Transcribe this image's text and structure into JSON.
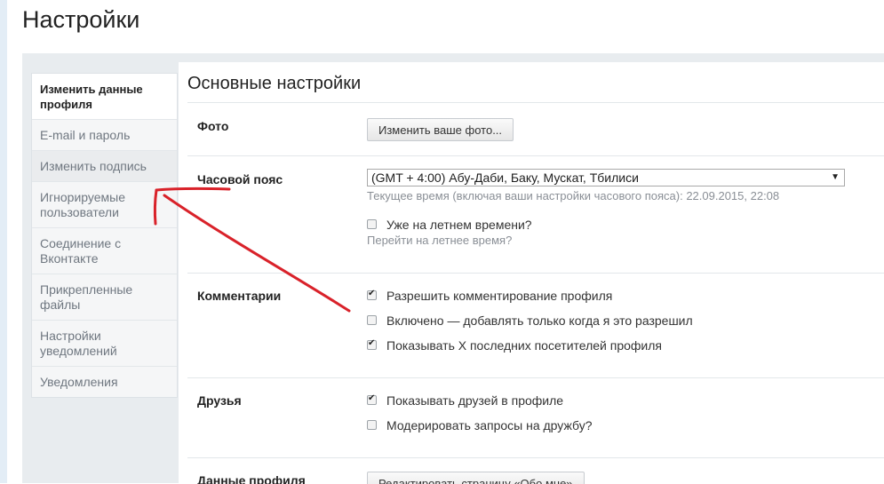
{
  "page_title": "Настройки",
  "sidebar": {
    "items": [
      {
        "label": "Изменить данные профиля"
      },
      {
        "label": "E-mail и пароль"
      },
      {
        "label": "Изменить подпись"
      },
      {
        "label": "Игнорируемые пользователи"
      },
      {
        "label": "Соединение с Вконтакте"
      },
      {
        "label": "Прикрепленные файлы"
      },
      {
        "label": "Настройки уведомлений"
      },
      {
        "label": "Уведомления"
      }
    ]
  },
  "main": {
    "title": "Основные настройки",
    "photo": {
      "label": "Фото",
      "button": "Изменить ваше фото..."
    },
    "timezone": {
      "label": "Часовой пояс",
      "selected": "(GMT + 4:00) Абу-Даби, Баку, Мускат, Тбилиси",
      "current_time": "Текущее время (включая ваши настройки часового пояса): 22.09.2015, 22:08",
      "dst_checkbox": "Уже на летнем времени?",
      "dst_hint": "Перейти на летнее время?"
    },
    "comments": {
      "label": "Комментарии",
      "options": [
        {
          "text": "Разрешить комментирование профиля",
          "checked": true
        },
        {
          "text": "Включено — добавлять только когда я это разрешил",
          "checked": false
        },
        {
          "text": "Показывать X последних посетителей профиля",
          "checked": true
        }
      ]
    },
    "friends": {
      "label": "Друзья",
      "options": [
        {
          "text": "Показывать друзей в профиле",
          "checked": true
        },
        {
          "text": "Модерировать запросы на дружбу?",
          "checked": false
        }
      ]
    },
    "profile_data": {
      "label": "Данные профиля",
      "button": "Редактировать страницу «Обо мне»"
    }
  },
  "annotation_color": "#d9222a"
}
